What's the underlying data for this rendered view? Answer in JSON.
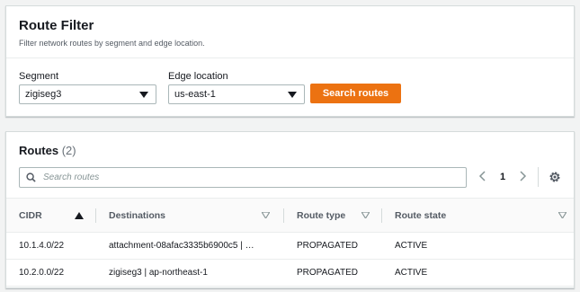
{
  "filter": {
    "title": "Route Filter",
    "description": "Filter network routes by segment and edge location.",
    "segment_label": "Segment",
    "segment_value": "zigiseg3",
    "edge_label": "Edge location",
    "edge_value": "us-east-1",
    "search_button": "Search routes"
  },
  "routes": {
    "title": "Routes",
    "count": "(2)",
    "search_placeholder": "Search routes",
    "page": "1",
    "columns": [
      "CIDR",
      "Destinations",
      "Route type",
      "Route state"
    ],
    "rows": [
      [
        "10.1.4.0/22",
        "attachment-08afac3335b6900c5 | …",
        "PROPAGATED",
        "ACTIVE"
      ],
      [
        "10.2.0.0/22",
        "zigiseg3 | ap-northeast-1",
        "PROPAGATED",
        "ACTIVE"
      ]
    ]
  },
  "colors": {
    "accent": "#ec7211",
    "background": "#f2f3f3",
    "panel": "#ffffff"
  },
  "icons": [
    "caret-down-icon",
    "search-icon",
    "chevron-left-icon",
    "chevron-right-icon",
    "gear-icon",
    "sort-ascending-icon",
    "sort-descending-icon"
  ]
}
